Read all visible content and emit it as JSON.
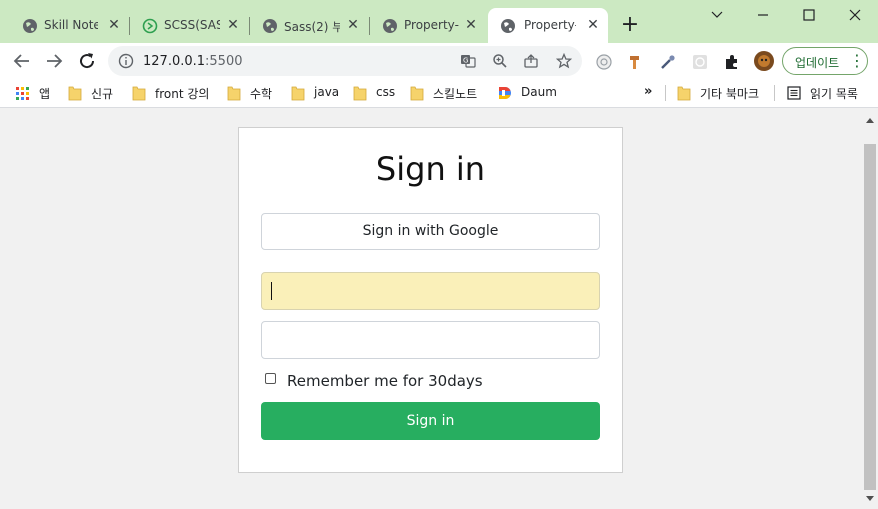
{
  "colors": {
    "tabstrip_bg": "#cce9c2",
    "signin_button_bg": "#27ae60",
    "autofill_bg": "#faf0b9",
    "update_button_text": "#1e6b31"
  },
  "browser": {
    "tabs": [
      {
        "title": "Skill Note",
        "icon": "globe-icon"
      },
      {
        "title": "SCSS(SASS",
        "icon": "sass-icon"
      },
      {
        "title": "Sass(2) 부",
        "icon": "globe-icon"
      },
      {
        "title": "Property-",
        "icon": "globe-icon"
      },
      {
        "title": "Property-S",
        "icon": "globe-icon",
        "active": true
      }
    ],
    "new_tab": "+",
    "window_controls": {
      "minimize": "–",
      "maximize": "□",
      "close": "✕"
    },
    "url_host": "127.0.0.1",
    "url_port": ":5500",
    "update_label": "업데이트",
    "update_menu": "⋮"
  },
  "bookmarks": {
    "items": [
      {
        "label": "앱",
        "icon": "apps-grid-icon"
      },
      {
        "label": "신규",
        "icon": "folder-icon"
      },
      {
        "label": "front 강의",
        "icon": "folder-icon"
      },
      {
        "label": "수학",
        "icon": "folder-icon"
      },
      {
        "label": "java",
        "icon": "folder-icon"
      },
      {
        "label": "css",
        "icon": "folder-icon"
      },
      {
        "label": "스킬노트",
        "icon": "folder-icon"
      },
      {
        "label": "Daum",
        "icon": "daum-icon"
      }
    ],
    "more": "»",
    "other_bookmarks": "기타 북마크",
    "reading_list": "읽기 목록"
  },
  "page": {
    "title": "Sign in",
    "google_button": "Sign in with Google",
    "username_value": "",
    "password_value": "",
    "remember_label": "Remember me for 30days",
    "remember_checked": false,
    "submit_label": "Sign in"
  }
}
